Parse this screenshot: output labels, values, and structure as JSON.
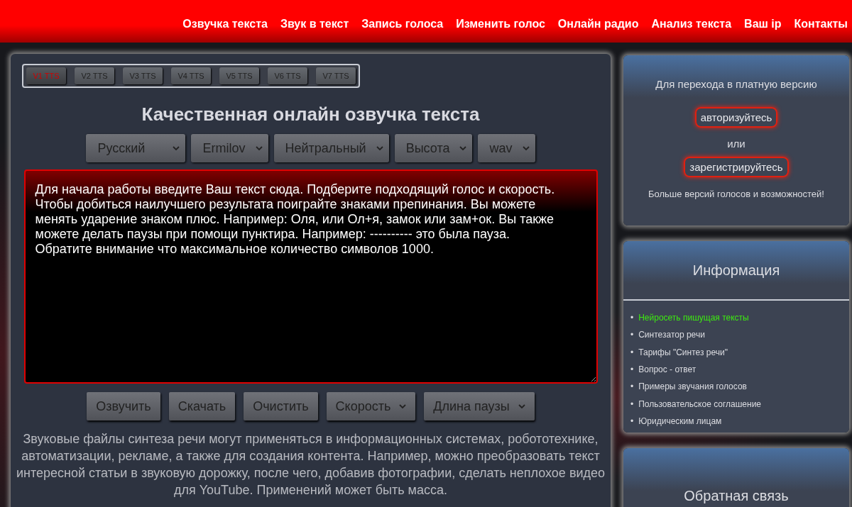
{
  "nav": [
    "Озвучка текста",
    "Звук в текст",
    "Запись голоса",
    "Изменить голос",
    "Онлайн радио",
    "Анализ текста",
    "Ваш ip",
    "Контакты"
  ],
  "version_tabs": [
    {
      "label": "V1 TTS",
      "selected": true
    },
    {
      "label": "V2 TTS",
      "selected": false
    },
    {
      "label": "V3 TTS",
      "selected": false
    },
    {
      "label": "V4 TTS",
      "selected": false
    },
    {
      "label": "V5 TTS",
      "selected": false
    },
    {
      "label": "V6 TTS",
      "selected": false
    },
    {
      "label": "V7 TTS",
      "selected": false
    }
  ],
  "heading": "Качественная онлайн озвучка текста",
  "selects": [
    "Русский",
    "Ermilov",
    "Нейтральный",
    "Высота",
    "wav"
  ],
  "text_input": {
    "value": "Для начала работы введите Ваш текст сюда. Подберите подходящий голос и скорость. Чтобы добиться наилучшего результата поиграйте знаками препинания. Вы можете менять ударение знаком плюс. Например: Оля, или Ол+я, замок или зам+ок. Вы также можете делать паузы при помощи пунктира. Например: ---------- это была пауза. Обратите внимание что максимальное количество символов 1000."
  },
  "actions": [
    {
      "kind": "button",
      "label": "Озвучить"
    },
    {
      "kind": "button",
      "label": "Скачать"
    },
    {
      "kind": "button",
      "label": "Очистить"
    },
    {
      "kind": "select",
      "label": "Скорость"
    },
    {
      "kind": "select",
      "label": "Длина паузы"
    }
  ],
  "description": "Звуковые файлы синтеза речи могут применяться в информационных системах, робототехнике, автоматизации, рекламе, а также для создания контента. Например, можно преобразовать текст интересной статьи в звуковую дорожку, после чего, добавив фотографии, сделать неплохое видео для YouTube. Применений может быть масса.",
  "paid_card": {
    "title": "Для перехода в платную версию",
    "login": "авторизуйтесь",
    "or": "или",
    "register": "зарегистрируйтесь",
    "note": "Больше версий голосов и возможностей!"
  },
  "info_card": {
    "title": "Информация",
    "bullet": "•",
    "links": [
      {
        "label": "Нейросеть пишущая тексты",
        "selected": true
      },
      {
        "label": "Синтезатор речи",
        "selected": false
      },
      {
        "label": "Тарифы \"Синтез речи\"",
        "selected": false
      },
      {
        "label": "Вопрос - ответ",
        "selected": false
      },
      {
        "label": "Примеры звучания голосов",
        "selected": false
      },
      {
        "label": "Пользовательское соглашение",
        "selected": false
      },
      {
        "label": "Юридическим лицам",
        "selected": false
      }
    ]
  },
  "feedback_card": {
    "title": "Обратная связь"
  }
}
